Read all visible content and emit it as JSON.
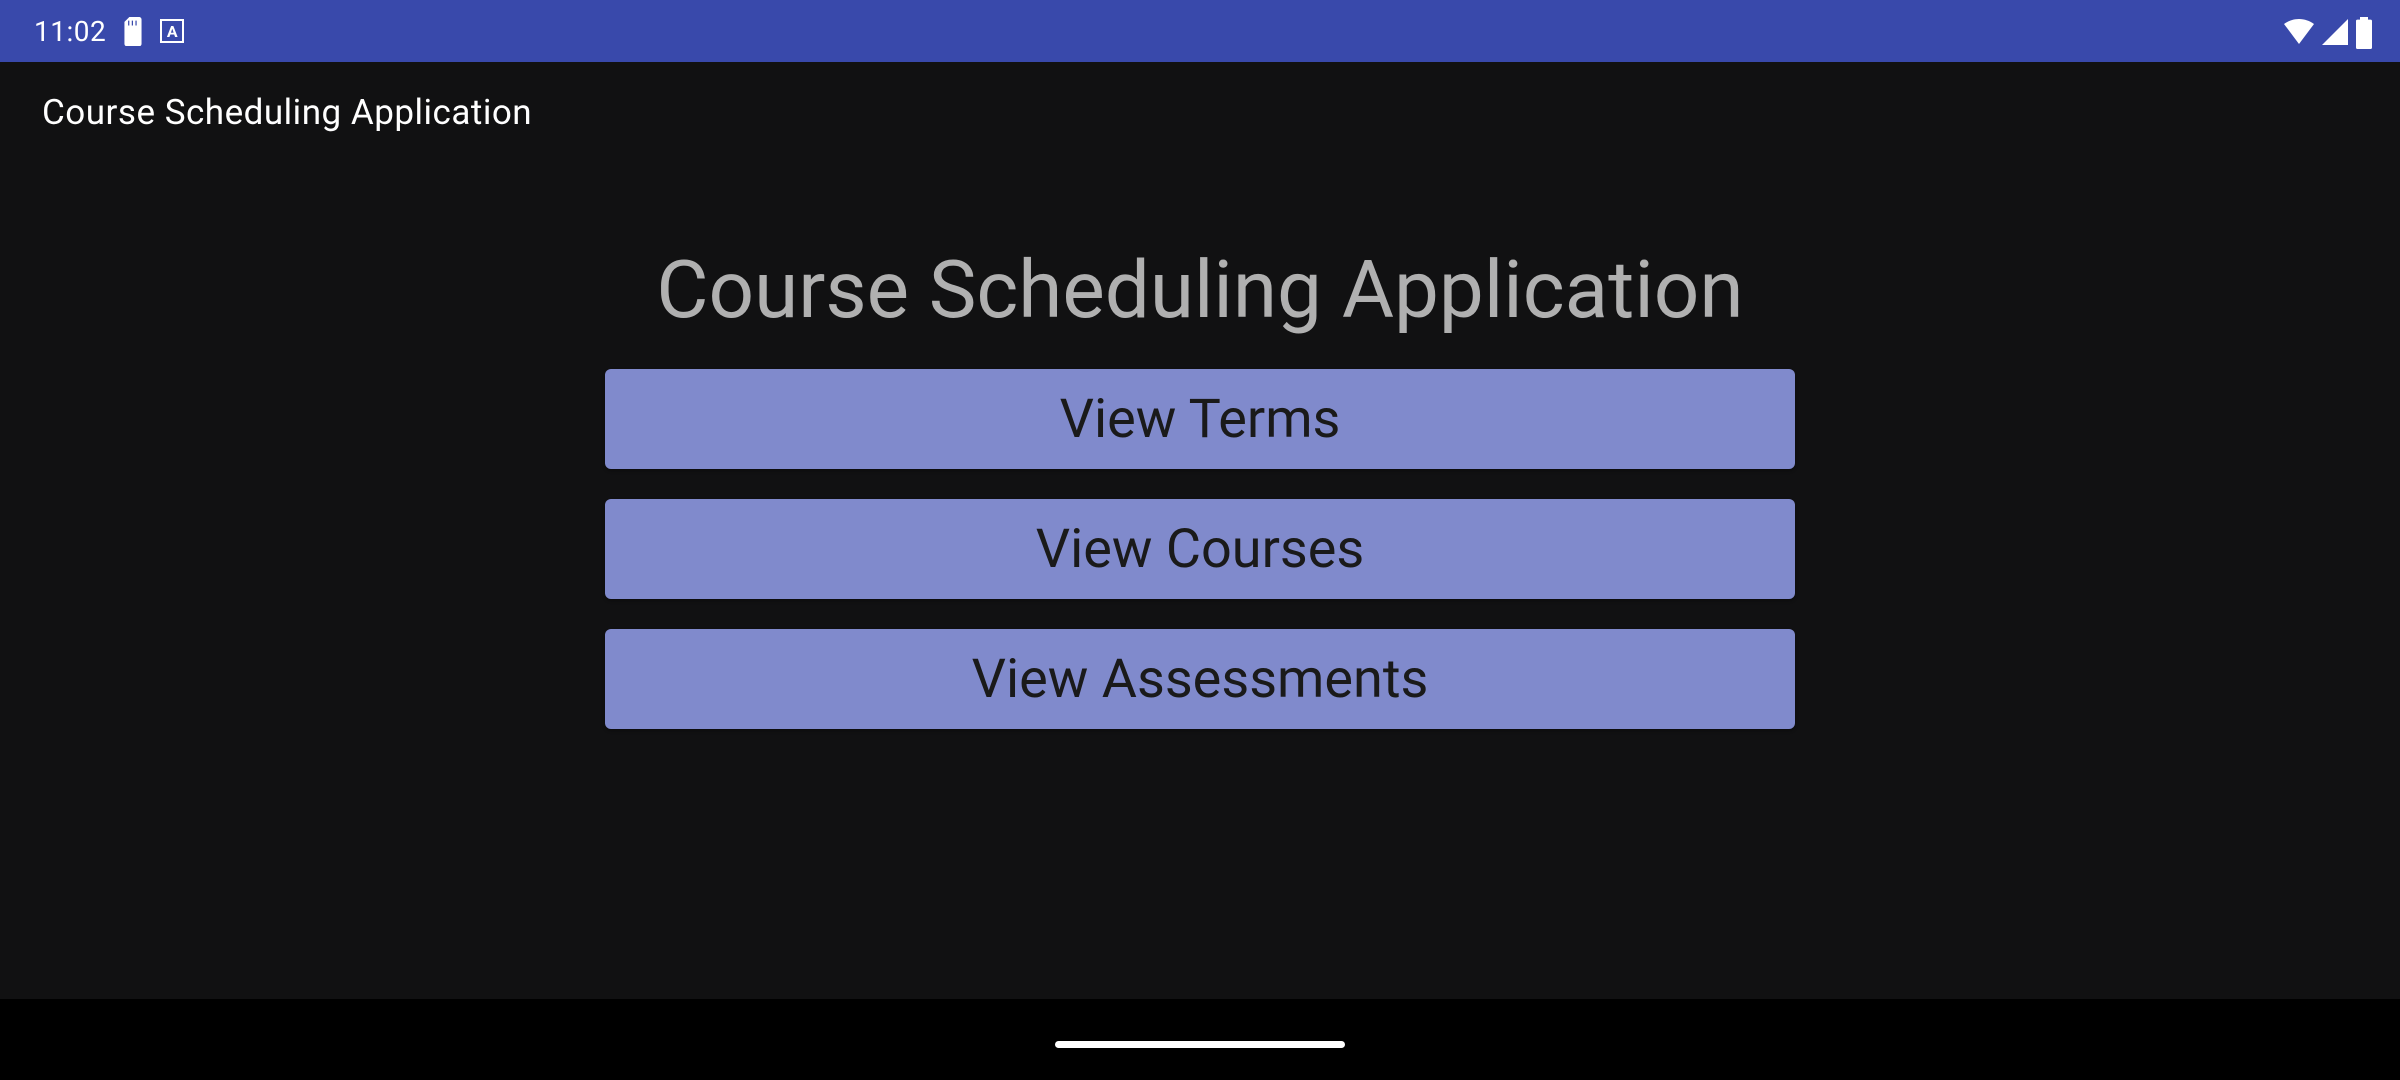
{
  "status_bar": {
    "time": "11:02"
  },
  "app_bar": {
    "title": "Course Scheduling Application"
  },
  "main": {
    "heading": "Course Scheduling Application",
    "buttons": {
      "terms": "View Terms",
      "courses": "View Courses",
      "assessments": "View Assessments"
    }
  },
  "colors": {
    "status_bar_bg": "#3949ab",
    "button_bg": "#808acc",
    "app_bg": "#111112"
  }
}
